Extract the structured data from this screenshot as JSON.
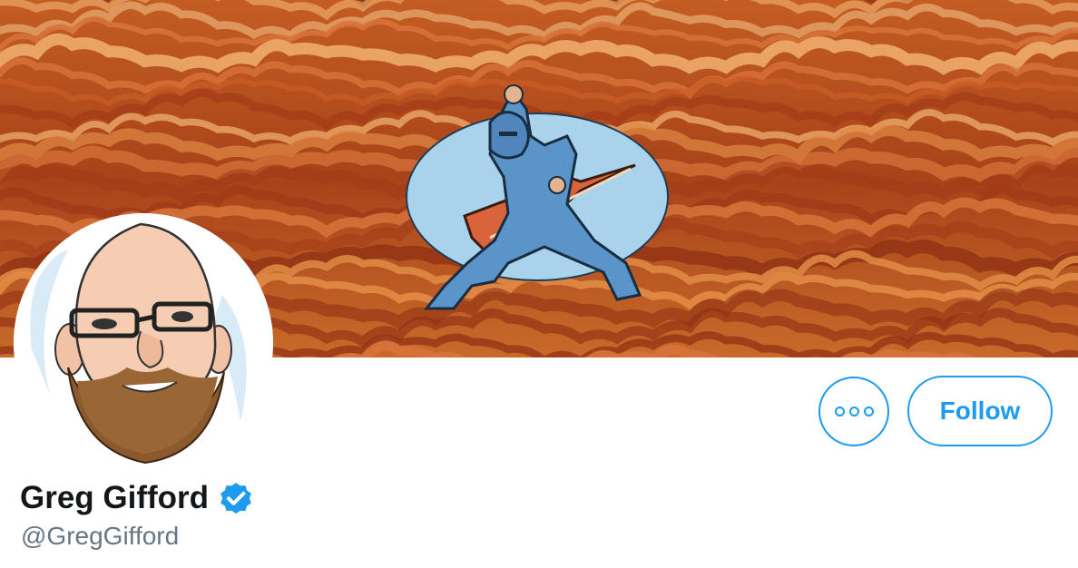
{
  "profile": {
    "display_name": "Greg Gifford",
    "handle": "@GregGifford",
    "verified": true,
    "verified_icon": "verified-badge-icon"
  },
  "actions": {
    "more_icon": "more-options-icon",
    "follow_label": "Follow"
  },
  "colors": {
    "accent": "#1d9bf0",
    "name_text": "#14171a",
    "handle_text": "#657786",
    "banner_base": "#b3521c"
  }
}
